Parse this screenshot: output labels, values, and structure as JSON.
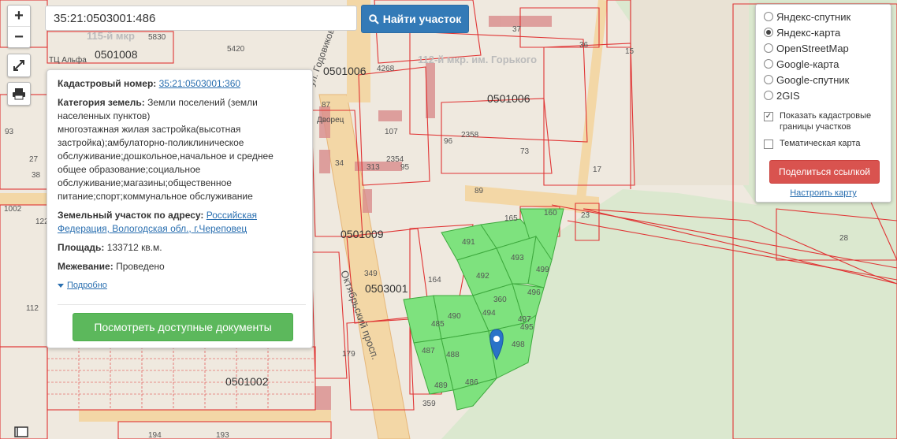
{
  "search": {
    "value": "35:21:0503001:486",
    "button_label": "Найти участок"
  },
  "zoom": {
    "in_label": "+",
    "out_label": "−"
  },
  "info": {
    "cadastral_label": "Кадастровый номер:",
    "cadastral_number": "35:21:0503001:360",
    "category_label": "Категория земель:",
    "category_value": "Земли поселений (земли населенных пунктов)",
    "use_value": "многоэтажная жилая застройка(высотная застройка);амбулаторно-поликлиническое обслуживание;дошкольное,начальное и среднее общее образование;социальное обслуживание;магазины;общественное питание;спорт;коммунальное обслуживание",
    "address_label": "Земельный участок по адресу:",
    "address_value": "Российская Федерация, Вологодская обл., г.Череповец",
    "area_label": "Площадь:",
    "area_value": "133712 кв.м.",
    "survey_label": "Межевание:",
    "survey_value": "Проведено",
    "more_label": "Подробно",
    "docs_button": "Посмотреть доступные документы"
  },
  "layers": {
    "options": [
      {
        "label": "Яндекс-спутник",
        "selected": false
      },
      {
        "label": "Яндекс-карта",
        "selected": true
      },
      {
        "label": "OpenStreetMap",
        "selected": false
      },
      {
        "label": "Google-карта",
        "selected": false
      },
      {
        "label": "Google-спутник",
        "selected": false
      },
      {
        "label": "2GIS",
        "selected": false
      }
    ],
    "show_boundaries_label": "Показать кадастровые границы участков",
    "show_boundaries_checked": true,
    "thematic_label": "Тематическая карта",
    "thematic_checked": false,
    "share_button": "Поделиться ссылкой",
    "config_link": "Настроить карту"
  },
  "map_labels": {
    "quarters": [
      "0501008",
      "0501006",
      "0501006",
      "0501009",
      "0503001",
      "0501002"
    ],
    "districts": [
      "115-й мкр",
      "112-й мкр. им. Горького"
    ],
    "streets": [
      "ул. Годовикова",
      "Октябрьский просп."
    ],
    "poi": [
      "ТЦ Альфа",
      "Дворец"
    ],
    "parcels": [
      "5830",
      "5420",
      "4268",
      "37",
      "36",
      "15",
      "87",
      "107",
      "96",
      "2358",
      "73",
      "17",
      "34",
      "95",
      "2354",
      "313",
      "89",
      "165",
      "160",
      "23",
      "28",
      "491",
      "492",
      "493",
      "360",
      "494",
      "495",
      "496",
      "497",
      "498",
      "499",
      "485",
      "486",
      "487",
      "488",
      "489",
      "490",
      "349",
      "164",
      "179",
      "112",
      "122",
      "93",
      "27",
      "38",
      "193",
      "194",
      "1002",
      "359"
    ],
    "colors": {
      "highlight_fill": "#7ee27e",
      "highlight_stroke": "#3ea93e",
      "boundary": "#e03434",
      "road": "#f3d7a6",
      "background": "#efe9df",
      "green_area": "#dbe8cf"
    }
  }
}
